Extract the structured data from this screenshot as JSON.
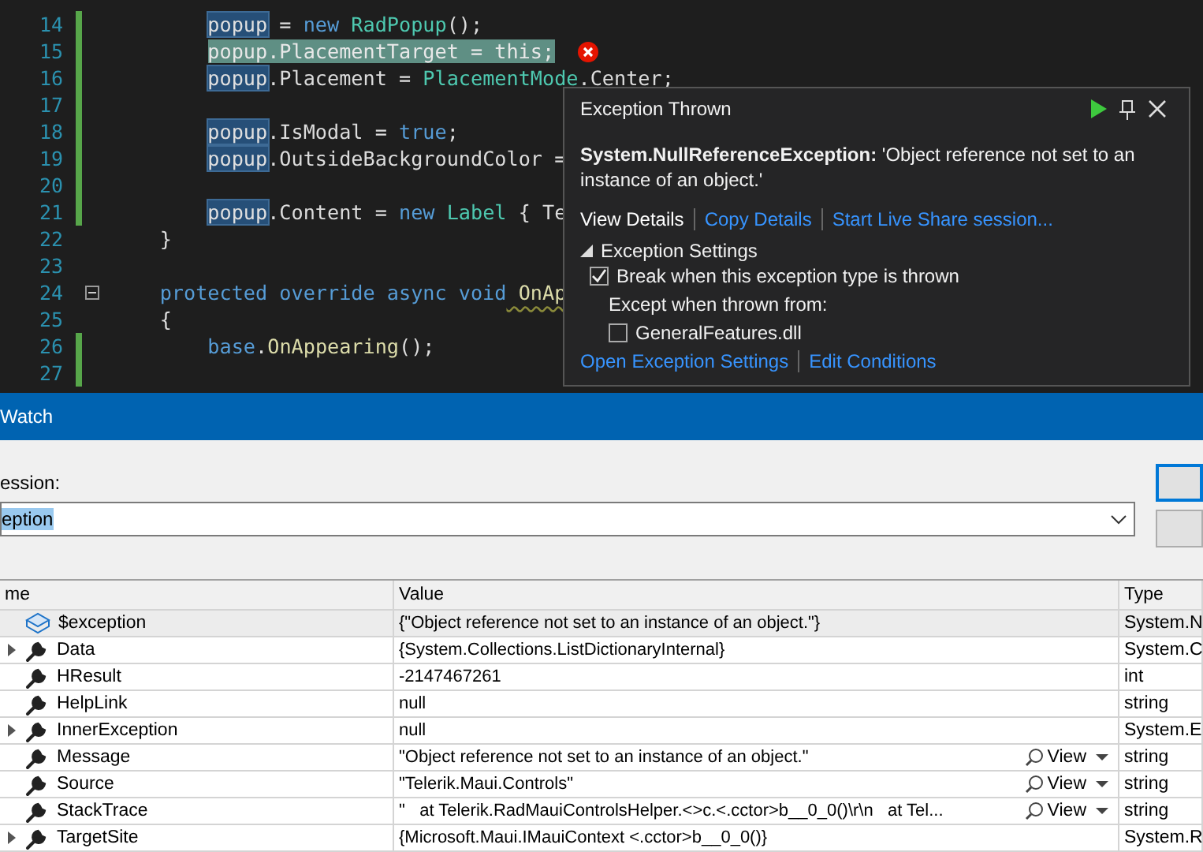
{
  "editor": {
    "lines": [
      {
        "number": "14",
        "changed": true,
        "tokens": [
          {
            "text": "        popup",
            "kind": "ref"
          },
          {
            "text": " = ",
            "kind": "plain"
          },
          {
            "text": "new",
            "kind": "kw"
          },
          {
            "text": " RadPopup",
            "kind": "type"
          },
          {
            "text": "();",
            "kind": "plain"
          }
        ]
      },
      {
        "number": "15",
        "changed": true,
        "current": true,
        "error": true,
        "tokens": [
          {
            "text": "        popup.PlacementTarget = this;",
            "kind": "plain"
          }
        ]
      },
      {
        "number": "16",
        "changed": true,
        "tokens": [
          {
            "text": "        popup",
            "kind": "ref"
          },
          {
            "text": ".Placement = ",
            "kind": "plain"
          },
          {
            "text": "PlacementMode",
            "kind": "type"
          },
          {
            "text": ".Center;",
            "kind": "plain"
          }
        ]
      },
      {
        "number": "17",
        "changed": true
      },
      {
        "number": "18",
        "changed": true,
        "tokens": [
          {
            "text": "        popup",
            "kind": "ref"
          },
          {
            "text": ".IsModal = ",
            "kind": "plain"
          },
          {
            "text": "true",
            "kind": "kw"
          },
          {
            "text": ";",
            "kind": "plain"
          }
        ]
      },
      {
        "number": "19",
        "changed": true,
        "tokens": [
          {
            "text": "        popup",
            "kind": "ref"
          },
          {
            "text": ".OutsideBackgroundColor =",
            "kind": "plain"
          }
        ]
      },
      {
        "number": "20",
        "changed": true
      },
      {
        "number": "21",
        "changed": true,
        "tokens": [
          {
            "text": "        popup",
            "kind": "ref"
          },
          {
            "text": ".Content = ",
            "kind": "plain"
          },
          {
            "text": "new",
            "kind": "kw"
          },
          {
            "text": " Label",
            "kind": "type"
          },
          {
            "text": " { Te",
            "kind": "plain"
          }
        ]
      },
      {
        "number": "22",
        "changed": false,
        "tokens": [
          {
            "text": "    }",
            "kind": "plain"
          }
        ]
      },
      {
        "number": "23",
        "changed": false
      },
      {
        "number": "24",
        "changed": false,
        "fold": true,
        "tokens": [
          {
            "text": "    protected override async void",
            "kind": "kw"
          },
          {
            "text": " OnAp",
            "kind": "method",
            "warning": true
          }
        ]
      },
      {
        "number": "25",
        "changed": false,
        "tokens": [
          {
            "text": "    {",
            "kind": "plain"
          }
        ]
      },
      {
        "number": "26",
        "changed": true,
        "tokens": [
          {
            "text": "        base",
            "kind": "kw"
          },
          {
            "text": ".",
            "kind": "plain"
          },
          {
            "text": "OnAppearing",
            "kind": "method"
          },
          {
            "text": "();",
            "kind": "plain"
          }
        ]
      },
      {
        "number": "27",
        "changed": true
      }
    ]
  },
  "exception_popup": {
    "title": "Exception Thrown",
    "message": "**System.NullReferenceException:** 'Object reference not set to an instance of an object.'",
    "links": [
      {
        "label": "View Details",
        "selected": true
      },
      {
        "label": "Copy Details",
        "selected": false
      },
      {
        "label": "Start Live Share session...",
        "selected": false
      }
    ],
    "settings": {
      "title": "Exception Settings",
      "expanded": true,
      "break_option": {
        "label": "Break when this exception type is thrown",
        "checked": true
      },
      "except_label": "Except when thrown from:",
      "modules": [
        {
          "label": "GeneralFeatures.dll",
          "checked": false
        }
      ]
    },
    "footer_links": [
      "Open Exception Settings",
      "Edit Conditions"
    ]
  },
  "quickwatch": {
    "title": "Watch",
    "expression_label": "ession:",
    "expression": "eption",
    "columns": [
      "me",
      "Value",
      "Type"
    ],
    "rows": [
      {
        "name": "$exception",
        "kind": "object",
        "expandable": false,
        "selected": true,
        "value": "{\"Object reference not set to an instance of an object.\"}",
        "type": "System.N"
      },
      {
        "name": "Data",
        "kind": "property",
        "expandable": true,
        "selected": false,
        "value": "{System.Collections.ListDictionaryInternal}",
        "type": "System.C"
      },
      {
        "name": "HResult",
        "kind": "property",
        "expandable": false,
        "selected": false,
        "value": "-2147467261",
        "type": "int"
      },
      {
        "name": "HelpLink",
        "kind": "property",
        "expandable": false,
        "selected": false,
        "value": "null",
        "type": "string"
      },
      {
        "name": "InnerException",
        "kind": "property",
        "expandable": true,
        "selected": false,
        "value": "null",
        "type": "System.E"
      },
      {
        "name": "Message",
        "kind": "property",
        "expandable": false,
        "selected": false,
        "value": "\"Object reference not set to an instance of an object.\"",
        "view": "View",
        "type": "string"
      },
      {
        "name": "Source",
        "kind": "property",
        "expandable": false,
        "selected": false,
        "value": "\"Telerik.Maui.Controls\"",
        "view": "View",
        "type": "string"
      },
      {
        "name": "StackTrace",
        "kind": "property",
        "expandable": false,
        "selected": false,
        "value": "\"   at Telerik.RadMauiControlsHelper.<>c.<.cctor>b__0_0()\\r\\n   at Tel...",
        "view": "View",
        "type": "string"
      },
      {
        "name": "TargetSite",
        "kind": "property",
        "expandable": true,
        "selected": false,
        "value": "{Microsoft.Maui.IMauiContext <.cctor>b__0_0()}",
        "type": "System.R"
      }
    ]
  }
}
